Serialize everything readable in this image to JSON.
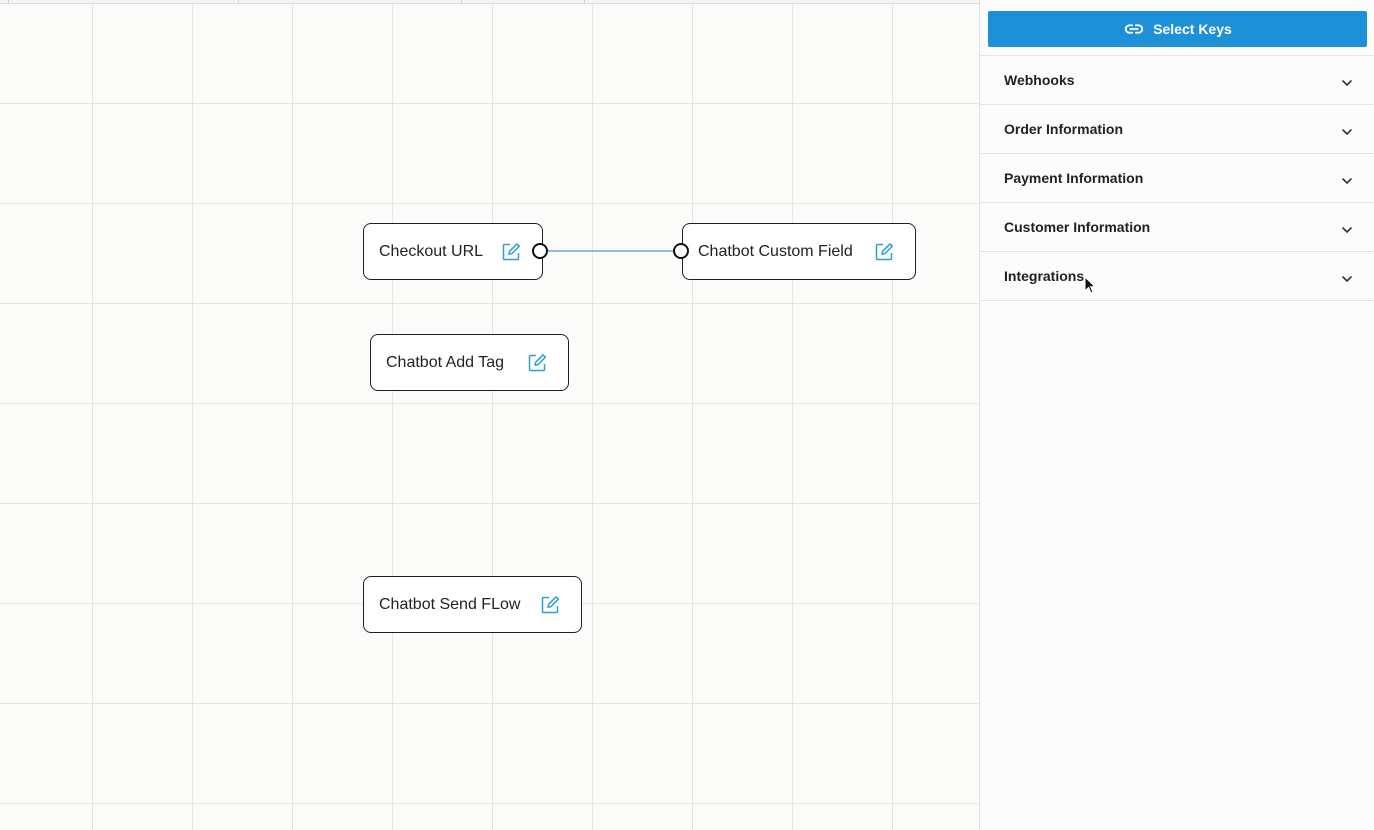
{
  "canvas": {
    "nodes": [
      {
        "label": "Checkout URL"
      },
      {
        "label": "Chatbot Custom Field"
      },
      {
        "label": "Chatbot Add Tag"
      },
      {
        "label": "Chatbot Send FLow"
      }
    ],
    "edge_color": "#6aa8e0"
  },
  "sidebar": {
    "select_keys_label": "Select Keys",
    "sections": [
      {
        "title": "Webhooks"
      },
      {
        "title": "Order Information"
      },
      {
        "title": "Payment Information"
      },
      {
        "title": "Customer Information"
      },
      {
        "title": "Integrations"
      }
    ]
  },
  "colors": {
    "accent": "#1e90d8",
    "edit_icon": "#2a9fd6"
  }
}
